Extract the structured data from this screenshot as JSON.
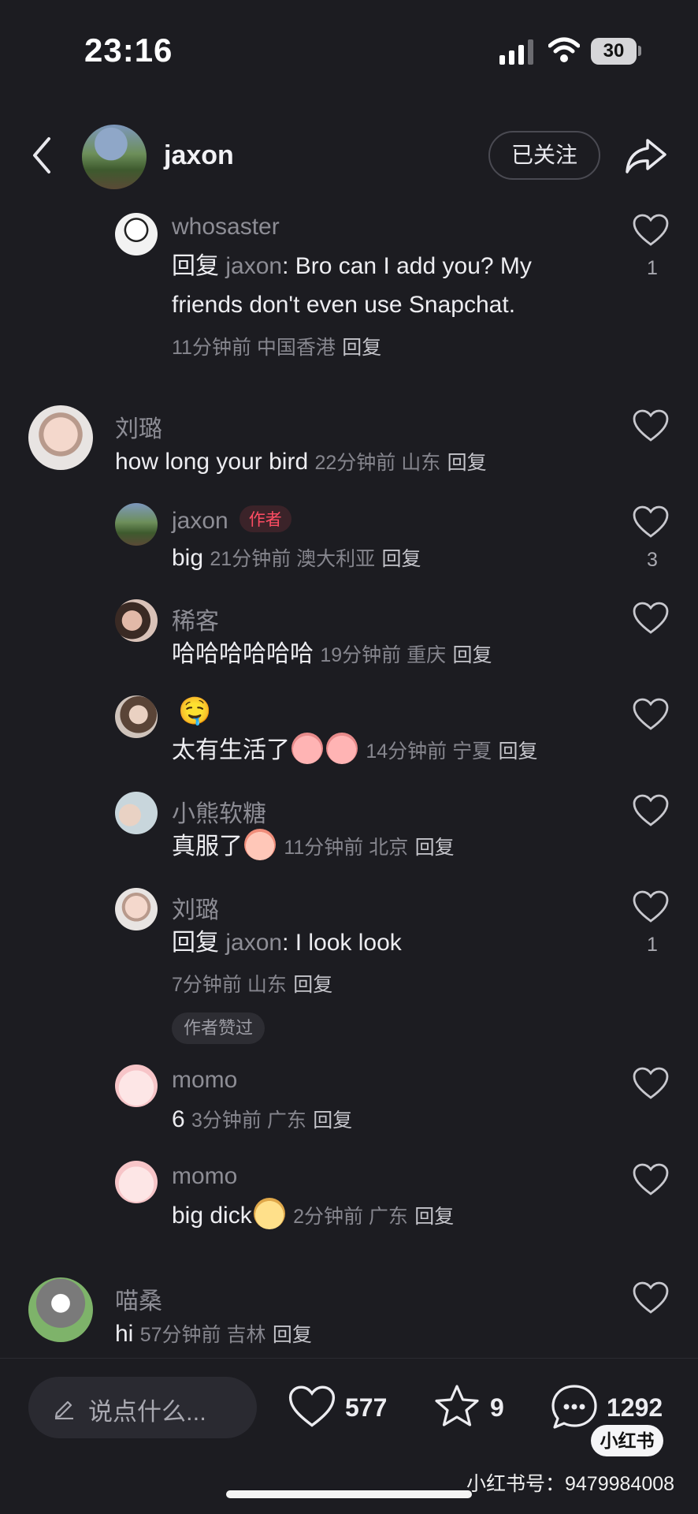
{
  "status": {
    "time": "23:16",
    "battery": "30"
  },
  "header": {
    "name": "jaxon",
    "follow_label": "已关注"
  },
  "comments": [
    {
      "name": "whosaster",
      "prefix": "回复 ",
      "mention": "jaxon",
      "text_line1": ": Bro can I add you? My",
      "text_line2": "friends don't even use Snapchat.",
      "meta": "11分钟前 中国香港",
      "reply": "回复",
      "likes": "1"
    },
    {
      "name": "刘璐",
      "text": "how long your bird",
      "meta": "22分钟前 山东",
      "reply": "回复"
    },
    {
      "name": "jaxon",
      "badge": "作者",
      "text": "big",
      "meta": "21分钟前 澳大利亚",
      "reply": "回复",
      "likes": "3"
    },
    {
      "name": "稀客",
      "text": "哈哈哈哈哈哈",
      "meta": "19分钟前 重庆",
      "reply": "回复"
    },
    {
      "name": "🤤",
      "text": "太有生活了",
      "meta": "14分钟前 宁夏",
      "reply": "回复"
    },
    {
      "name": "小熊软糖",
      "text": "真服了",
      "meta": "11分钟前 北京",
      "reply": "回复"
    },
    {
      "name": "刘璐",
      "prefix": "回复 ",
      "mention": "jaxon",
      "text": ": I look look",
      "meta": "7分钟前 山东",
      "reply": "回复",
      "likes": "1",
      "liked_by_author": "作者赞过"
    },
    {
      "name": "momo",
      "text": "6",
      "meta": "3分钟前 广东",
      "reply": "回复"
    },
    {
      "name": "momo",
      "text": "big dick",
      "meta": "2分钟前 广东",
      "reply": "回复"
    },
    {
      "name": "喵桑",
      "text": "hi",
      "meta": "57分钟前 吉林",
      "reply": "回复"
    }
  ],
  "bottom": {
    "input_placeholder": "说点什么...",
    "likes": "577",
    "stars": "9",
    "comments": "1292"
  },
  "watermark": {
    "logo": "小红书",
    "id_text": "小红书号：9479984008"
  },
  "colors": {
    "background": "#1c1c21",
    "author_badge": "#ff4d63"
  },
  "icons": [
    "back-arrow-icon",
    "share-arrow-icon",
    "heart-icon",
    "star-icon",
    "comment-bubble-icon",
    "pencil-icon",
    "wifi-icon",
    "signal-icon"
  ]
}
